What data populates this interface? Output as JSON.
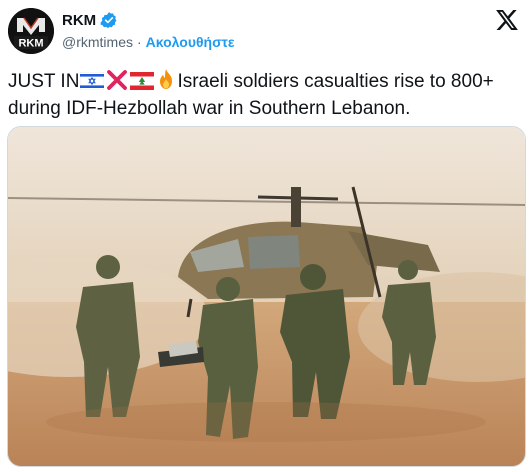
{
  "account": {
    "display_name": "RKM",
    "handle": "@rkmtimes",
    "separator": "·",
    "follow_label": "Ακολουθήστε",
    "avatar_text": "RKM"
  },
  "tweet": {
    "text_lead": "JUST IN",
    "text_body": "Israeli soldiers casualties rise to 800+ during IDF-Hezbollah war in Southern Lebanon."
  },
  "icons": [
    "verified-badge-icon",
    "x-logo-icon",
    "israel-flag-icon",
    "cross-mark-icon",
    "lebanon-flag-icon",
    "fire-icon"
  ],
  "colors": {
    "accent": "#1d9bf0",
    "text": "#0f1419",
    "muted": "#536471",
    "border": "#cfd9de"
  }
}
